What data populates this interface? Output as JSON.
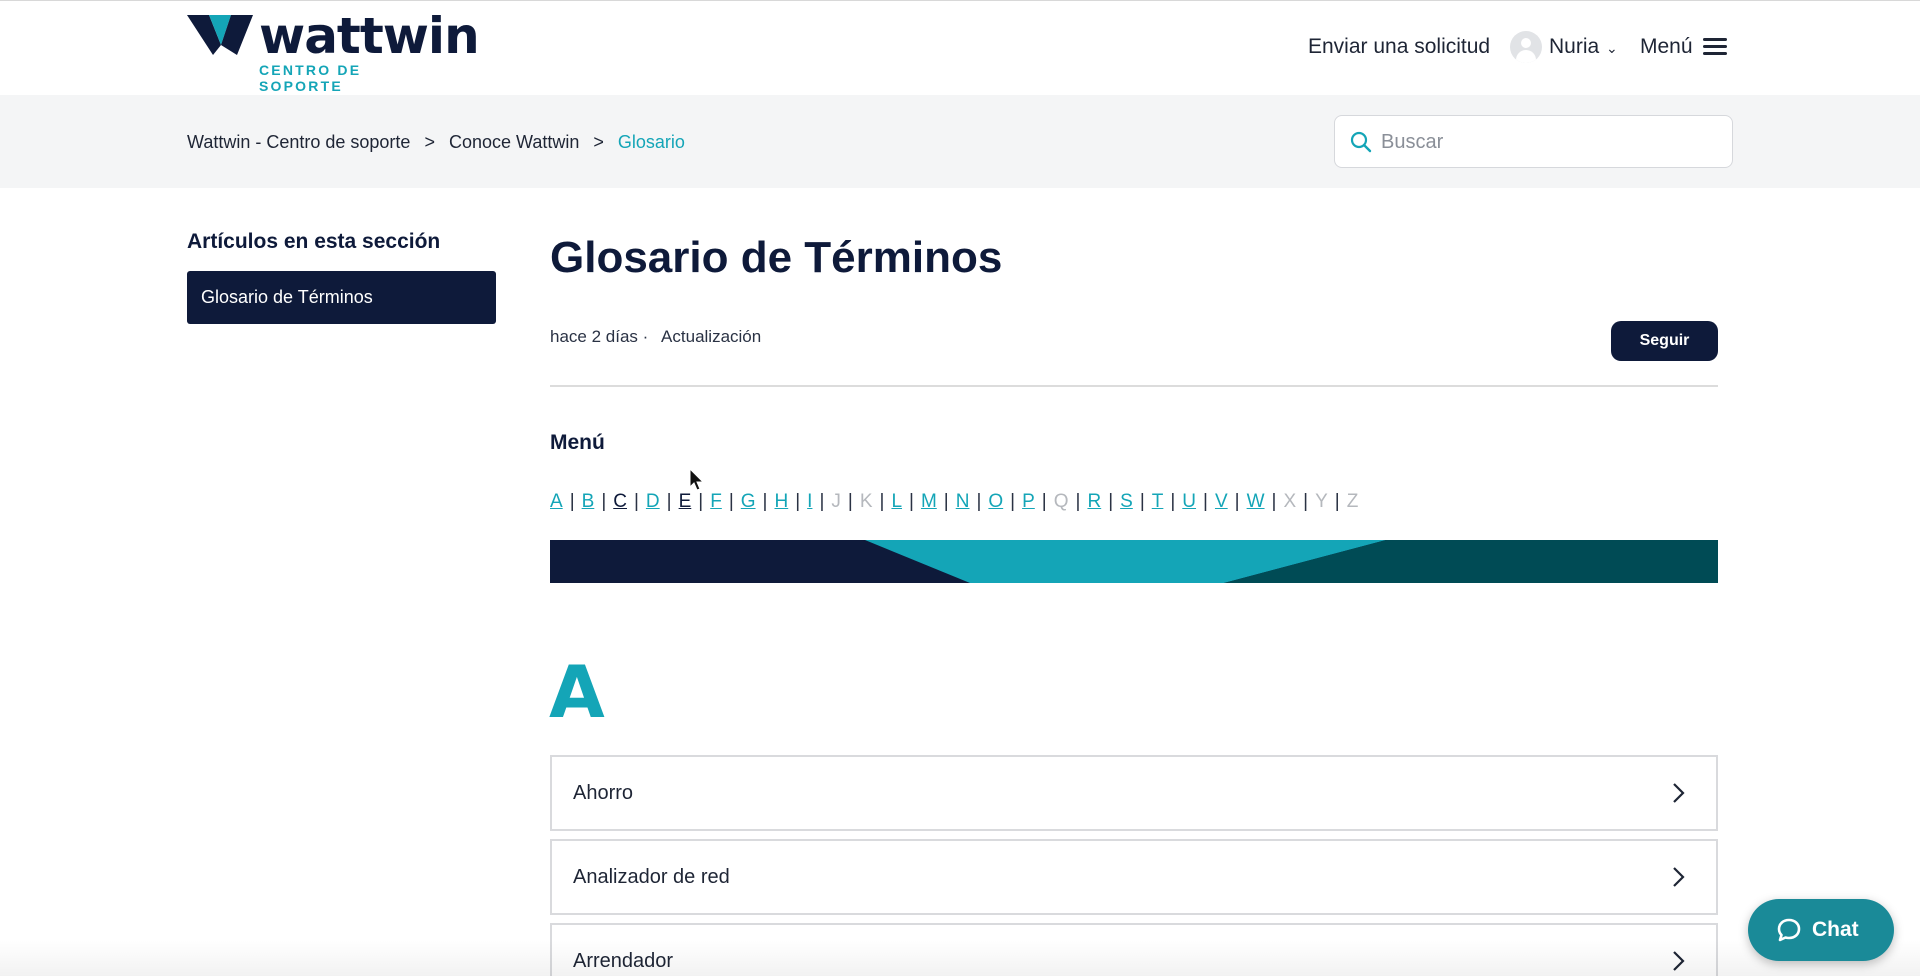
{
  "header": {
    "logo_word": "wattwin",
    "logo_sub": "CENTRO DE SOPORTE",
    "request_link": "Enviar una solicitud",
    "user_name": "Nuria",
    "menu_label": "Menú"
  },
  "breadcrumb": {
    "items": [
      "Wattwin - Centro de soporte",
      "Conoce Wattwin",
      "Glosario"
    ],
    "separator": ">"
  },
  "search": {
    "placeholder": "Buscar"
  },
  "sidebar": {
    "title": "Artículos en esta sección",
    "items": [
      {
        "label": "Glosario de Términos",
        "active": true
      }
    ]
  },
  "article": {
    "title": "Glosario de Términos",
    "age": "hace 2 días",
    "meta_sep": "·",
    "update_label": "Actualización",
    "follow_label": "Seguir",
    "menu_title": "Menú",
    "alphabet": [
      {
        "l": "A",
        "s": "link"
      },
      {
        "l": "B",
        "s": "link"
      },
      {
        "l": "C",
        "s": "dark"
      },
      {
        "l": "D",
        "s": "link"
      },
      {
        "l": "E",
        "s": "dark"
      },
      {
        "l": "F",
        "s": "link"
      },
      {
        "l": "G",
        "s": "link"
      },
      {
        "l": "H",
        "s": "link"
      },
      {
        "l": "I",
        "s": "link"
      },
      {
        "l": "J",
        "s": "off"
      },
      {
        "l": "K",
        "s": "off"
      },
      {
        "l": "L",
        "s": "link"
      },
      {
        "l": "M",
        "s": "link"
      },
      {
        "l": "N",
        "s": "link"
      },
      {
        "l": "O",
        "s": "link"
      },
      {
        "l": "P",
        "s": "link"
      },
      {
        "l": "Q",
        "s": "off"
      },
      {
        "l": "R",
        "s": "link"
      },
      {
        "l": "S",
        "s": "link"
      },
      {
        "l": "T",
        "s": "link"
      },
      {
        "l": "U",
        "s": "link"
      },
      {
        "l": "V",
        "s": "link"
      },
      {
        "l": "W",
        "s": "link"
      },
      {
        "l": "X",
        "s": "off"
      },
      {
        "l": "Y",
        "s": "off"
      },
      {
        "l": "Z",
        "s": "off"
      }
    ],
    "section_letter": "A",
    "terms": [
      "Ahorro",
      "Analizador de red",
      "Arrendador"
    ]
  },
  "chat": {
    "label": "Chat"
  },
  "colors": {
    "navy": "#0e1a3a",
    "teal": "#14a5b7",
    "dark_teal": "#004b55",
    "chat_bg": "#1a8a98"
  }
}
